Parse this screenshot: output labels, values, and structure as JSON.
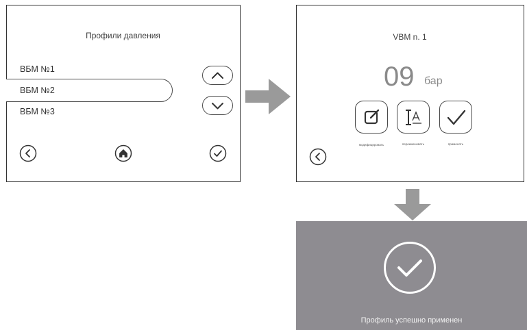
{
  "profiles_screen": {
    "title": "Профили давления",
    "items": [
      {
        "label": "ВБМ №1",
        "selected": false
      },
      {
        "label": "ВБМ №2",
        "selected": true
      },
      {
        "label": "ВБМ №3",
        "selected": false
      }
    ],
    "icons": {
      "up": "chevron-up-icon",
      "down": "chevron-down-icon",
      "back": "back-arrow-icon",
      "home": "home-icon",
      "confirm": "checkmark-icon"
    }
  },
  "profile_detail_screen": {
    "title": "VBM n. 1",
    "pressure_value": "09",
    "pressure_unit": "бар",
    "actions": [
      {
        "label": "модифицировать",
        "icon": "edit-icon"
      },
      {
        "label": "переименовать",
        "icon": "rename-icon"
      },
      {
        "label": "применять",
        "icon": "checkmark-icon"
      }
    ],
    "icons": {
      "back": "back-arrow-icon"
    }
  },
  "success_screen": {
    "message": "Профиль успешно применен",
    "icon": "checkmark-circle-icon",
    "background_color": "#8e8c91"
  },
  "flow_arrows": {
    "color": "#9a9a9a"
  }
}
